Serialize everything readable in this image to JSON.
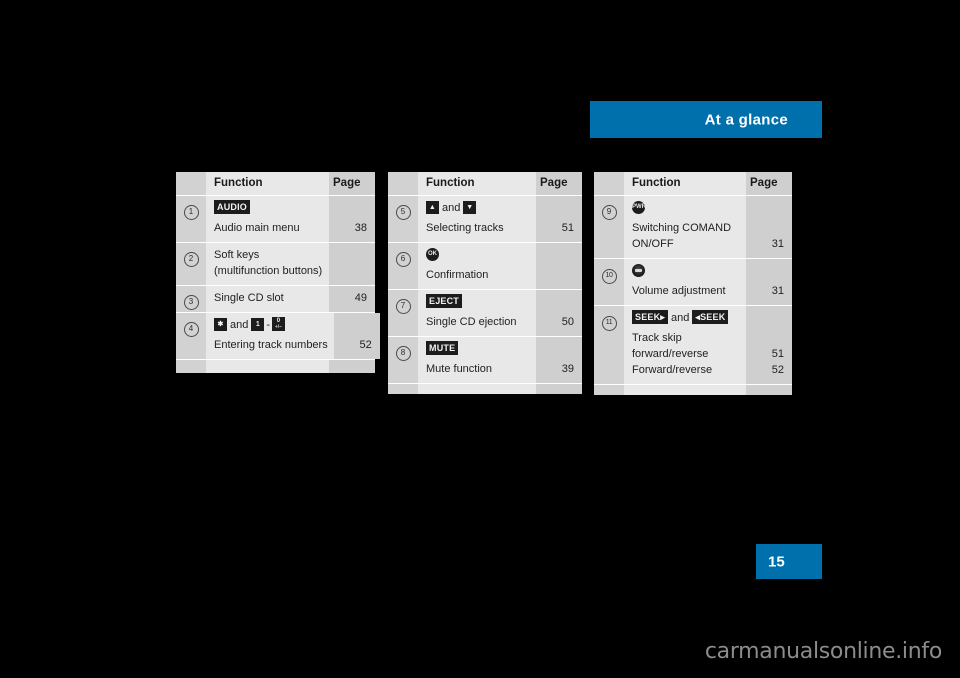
{
  "header": {
    "title": "At a glance",
    "accent_color": "#0070ad"
  },
  "page": {
    "number": "15",
    "box_color": "#0070ad"
  },
  "watermark": {
    "text": "carmanualsonline.info"
  },
  "tables": [
    {
      "id": "table-1",
      "columns": {
        "number": "",
        "function": "Function",
        "page": "Page"
      },
      "rows": [
        {
          "ref": "1",
          "key_line": {
            "keys": [
              {
                "type": "label",
                "text": "AUDIO"
              }
            ]
          },
          "text_lines": [
            "Audio main menu"
          ],
          "pages": [
            "38"
          ]
        },
        {
          "ref": "2",
          "key_line": null,
          "text_lines": [
            "Soft keys",
            "(multifunction buttons)"
          ],
          "pages": [
            "",
            ""
          ]
        },
        {
          "ref": "3",
          "key_line": null,
          "text_lines": [
            "Single CD slot"
          ],
          "pages": [
            "49"
          ]
        },
        {
          "ref": "4",
          "key_line": {
            "keys": [
              {
                "type": "square",
                "text": "✱"
              },
              {
                "type": "word",
                "text": "and"
              },
              {
                "type": "square",
                "text": "1"
              },
              {
                "type": "word",
                "text": "-"
              },
              {
                "type": "stacked",
                "text": "0",
                "sub": "+/−"
              }
            ]
          },
          "text_lines": [
            "Entering track numbers"
          ],
          "pages": [
            "52"
          ]
        }
      ]
    },
    {
      "id": "table-2",
      "columns": {
        "number": "",
        "function": "Function",
        "page": "Page"
      },
      "rows": [
        {
          "ref": "5",
          "key_line": {
            "keys": [
              {
                "type": "square",
                "text": "▲"
              },
              {
                "type": "word",
                "text": "and"
              },
              {
                "type": "square",
                "text": "▼"
              }
            ]
          },
          "text_lines": [
            "Selecting tracks"
          ],
          "pages": [
            "51"
          ]
        },
        {
          "ref": "6",
          "key_line": {
            "keys": [
              {
                "type": "round",
                "text": "OK"
              }
            ]
          },
          "text_lines": [
            "Confirmation"
          ],
          "pages": [
            ""
          ]
        },
        {
          "ref": "7",
          "key_line": {
            "keys": [
              {
                "type": "label",
                "text": "EJECT"
              }
            ]
          },
          "text_lines": [
            "Single CD ejection"
          ],
          "pages": [
            "50"
          ]
        },
        {
          "ref": "8",
          "key_line": {
            "keys": [
              {
                "type": "label",
                "text": "MUTE"
              }
            ]
          },
          "text_lines": [
            "Mute function"
          ],
          "pages": [
            "39"
          ]
        }
      ]
    },
    {
      "id": "table-3",
      "columns": {
        "number": "",
        "function": "Function",
        "page": "Page"
      },
      "rows": [
        {
          "ref": "9",
          "key_line": {
            "keys": [
              {
                "type": "round",
                "text": "PWR"
              }
            ]
          },
          "text_lines": [
            "Switching COMAND",
            "ON/OFF"
          ],
          "pages": [
            "",
            "31"
          ]
        },
        {
          "ref": "10",
          "key_line": {
            "keys": [
              {
                "type": "knob",
                "text": ""
              }
            ]
          },
          "text_lines": [
            "Volume adjustment"
          ],
          "pages": [
            "31"
          ]
        },
        {
          "ref": "11",
          "key_line": {
            "keys": [
              {
                "type": "label",
                "text": "SEEK▸"
              },
              {
                "type": "word",
                "text": "and"
              },
              {
                "type": "label",
                "text": "◂SEEK"
              }
            ]
          },
          "text_lines": [
            "Track skip",
            "forward/reverse",
            "Forward/reverse"
          ],
          "pages": [
            "",
            "51",
            "52"
          ]
        }
      ]
    }
  ]
}
